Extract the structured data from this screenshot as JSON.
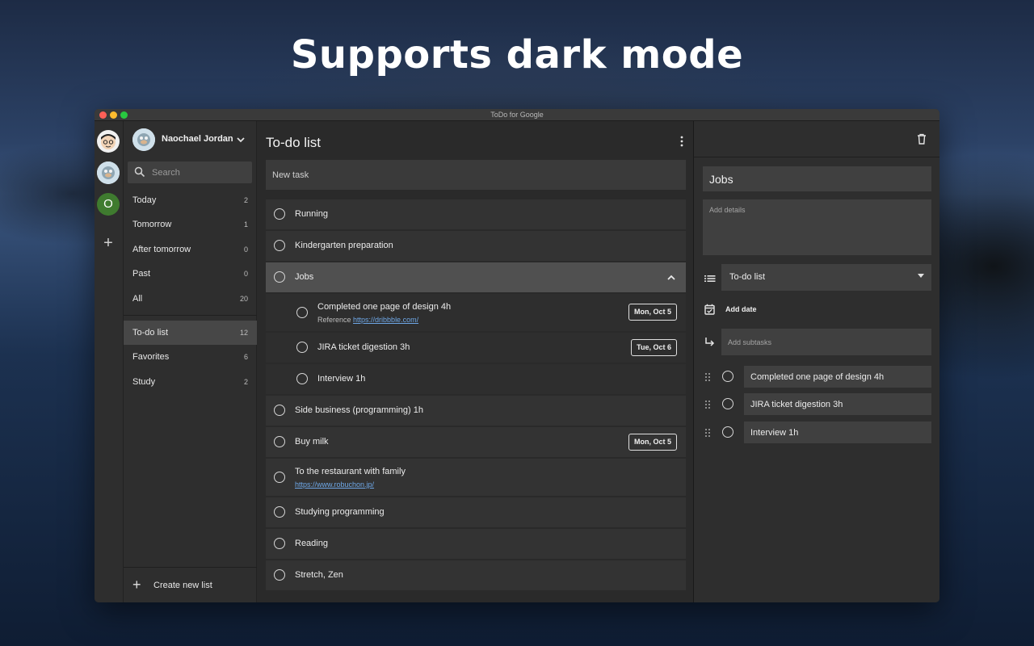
{
  "headline": "Supports dark mode",
  "window_title": "ToDo for Google",
  "rail": {
    "account3_initial": "O"
  },
  "user": {
    "name": "Naochael Jordan"
  },
  "search": {
    "placeholder": "Search"
  },
  "nav": [
    {
      "label": "Today",
      "count": "2"
    },
    {
      "label": "Tomorrow",
      "count": "1"
    },
    {
      "label": "After tomorrow",
      "count": "0"
    },
    {
      "label": "Past",
      "count": "0"
    },
    {
      "label": "All",
      "count": "20"
    }
  ],
  "lists": [
    {
      "label": "To-do list",
      "count": "12",
      "active": true
    },
    {
      "label": "Favorites",
      "count": "6"
    },
    {
      "label": "Study",
      "count": "2"
    }
  ],
  "create_list_label": "Create new list",
  "main": {
    "title": "To-do list",
    "new_task_placeholder": "New task",
    "tasks": [
      {
        "title": "Running"
      },
      {
        "title": "Kindergarten preparation"
      },
      {
        "title": "Jobs",
        "selected": true
      },
      {
        "title": "Completed one page of design 4h",
        "note_prefix": "Reference ",
        "link": "https://dribbble.com/",
        "date": "Mon, Oct 5",
        "subtask": true
      },
      {
        "title": "JIRA ticket digestion 3h",
        "date": "Tue, Oct 6",
        "subtask": true
      },
      {
        "title": "Interview 1h",
        "subtask": true
      },
      {
        "title": "Side business (programming) 1h"
      },
      {
        "title": "Buy milk",
        "date": "Mon, Oct 5"
      },
      {
        "title": "To the restaurant with family",
        "link": "https://www.robuchon.jp/"
      },
      {
        "title": "Studying programming"
      },
      {
        "title": "Reading"
      },
      {
        "title": "Stretch, Zen"
      }
    ]
  },
  "detail": {
    "title": "Jobs",
    "details_placeholder": "Add details",
    "list_select": "To-do list",
    "add_date": "Add date",
    "add_subtasks_placeholder": "Add subtasks",
    "subtasks": [
      "Completed one page of design 4h",
      "JIRA ticket digestion 3h",
      "Interview 1h"
    ]
  },
  "colors": {
    "background_dark": "#2a2a2a",
    "panel": "#2e2e2e",
    "input": "#404040",
    "link": "#6ea7e6",
    "selected_row": "#505050",
    "avatar_green": "#3f7b2f"
  },
  "icons": [
    "search-icon",
    "chevron-down-icon",
    "more-vertical-icon",
    "chevron-up-icon",
    "trash-icon",
    "list-icon",
    "calendar-icon",
    "subtask-arrow-icon",
    "drag-handle-icon",
    "plus-icon"
  ]
}
